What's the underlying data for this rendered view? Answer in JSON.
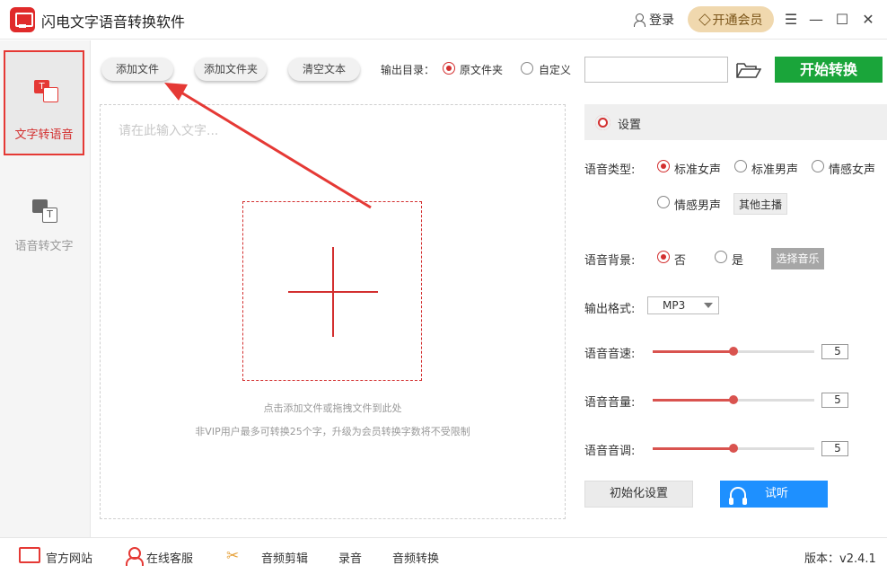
{
  "app": {
    "title": "闪电文字语音转换软件"
  },
  "titlebar": {
    "login": "登录",
    "vip": "开通会员",
    "menu": "☰",
    "minimize": "—",
    "maximize": "☐",
    "close": "✕"
  },
  "sidebar": {
    "items": [
      {
        "label": "文字转语音",
        "icon_text": "T"
      },
      {
        "label": "语音转文字",
        "icon_text": "T"
      }
    ]
  },
  "toolbar": {
    "add_file": "添加文件",
    "add_folder": "添加文件夹",
    "clear_text": "清空文本",
    "output_label": "输出目录：",
    "opt_original": "原文件夹",
    "opt_custom": "自定义",
    "path_value": "",
    "start": "开始转换"
  },
  "editor": {
    "placeholder": "请在此输入文字...",
    "hint1": "点击添加文件或拖拽文件到此处",
    "hint2": "非VIP用户最多可转换25个字，升级为会员转换字数将不受限制"
  },
  "settings": {
    "title": "设置",
    "voice_type_label": "语音类型:",
    "voices": [
      "标准女声",
      "标准男声",
      "情感女声",
      "情感男声"
    ],
    "voice_selected": "标准女声",
    "other_anchor": "其他主播",
    "bg_label": "语音背景:",
    "bg_no": "否",
    "bg_yes": "是",
    "bg_selected": "否",
    "choose_music": "选择音乐",
    "format_label": "输出格式:",
    "format_value": "MP3",
    "speed_label": "语音音速:",
    "speed_value": "5",
    "volume_label": "语音音量:",
    "volume_value": "5",
    "pitch_label": "语音音调:",
    "pitch_value": "5",
    "slider_level": 0.5,
    "reset": "初始化设置",
    "listen": "试听"
  },
  "bottombar": {
    "website": "官方网站",
    "support": "在线客服",
    "audio_edit": "音频剪辑",
    "record": "录音",
    "audio_convert": "音频转换",
    "version": "版本：v2.4.1"
  },
  "colors": {
    "accent_red": "#d32f2f",
    "start_green": "#1aa53a",
    "listen_blue": "#1e90ff",
    "vip_gold": "#f0d8ae"
  }
}
